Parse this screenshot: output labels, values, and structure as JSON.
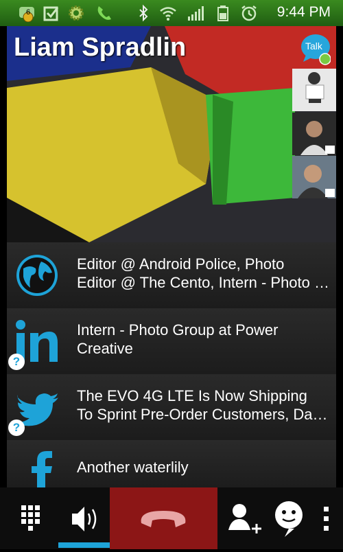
{
  "status_bar": {
    "time": "9:44 PM",
    "notification_badge": "6",
    "icons": [
      "notification-counter-icon",
      "checkbox-icon",
      "gear-icon",
      "phone-icon",
      "bluetooth-icon",
      "wifi-icon",
      "signal-icon",
      "battery-icon",
      "alarm-icon"
    ]
  },
  "contact": {
    "name": "Liam Spradlin",
    "talk_label": "Talk",
    "talk_status_color": "#7ac943"
  },
  "updates": [
    {
      "source": "globe-icon",
      "lines": [
        "Editor @ Android Police, Photo",
        "Editor @ The Cento, Intern - Photo Group at Power Creative"
      ]
    },
    {
      "source": "linkedin-icon",
      "lines": [
        "Intern - Photo Group at Power",
        "Creative"
      ],
      "badge": "?"
    },
    {
      "source": "twitter-icon",
      "lines": [
        "The EVO 4G LTE Is Now Shipping",
        "To Sprint Pre-Order Customers, Dan Bader"
      ],
      "badge": "?"
    },
    {
      "source": "facebook-icon",
      "lines": [
        "Another waterlily"
      ]
    }
  ],
  "call_bar": {
    "buttons": [
      "dialpad-icon",
      "speaker-icon",
      "end-call-icon",
      "add-call-icon",
      "chat-icon",
      "more-icon"
    ],
    "end_call_color": "#8c1616"
  },
  "colors": {
    "accent_blue": "#1ea3d8",
    "status_green": "#2f7a19"
  }
}
